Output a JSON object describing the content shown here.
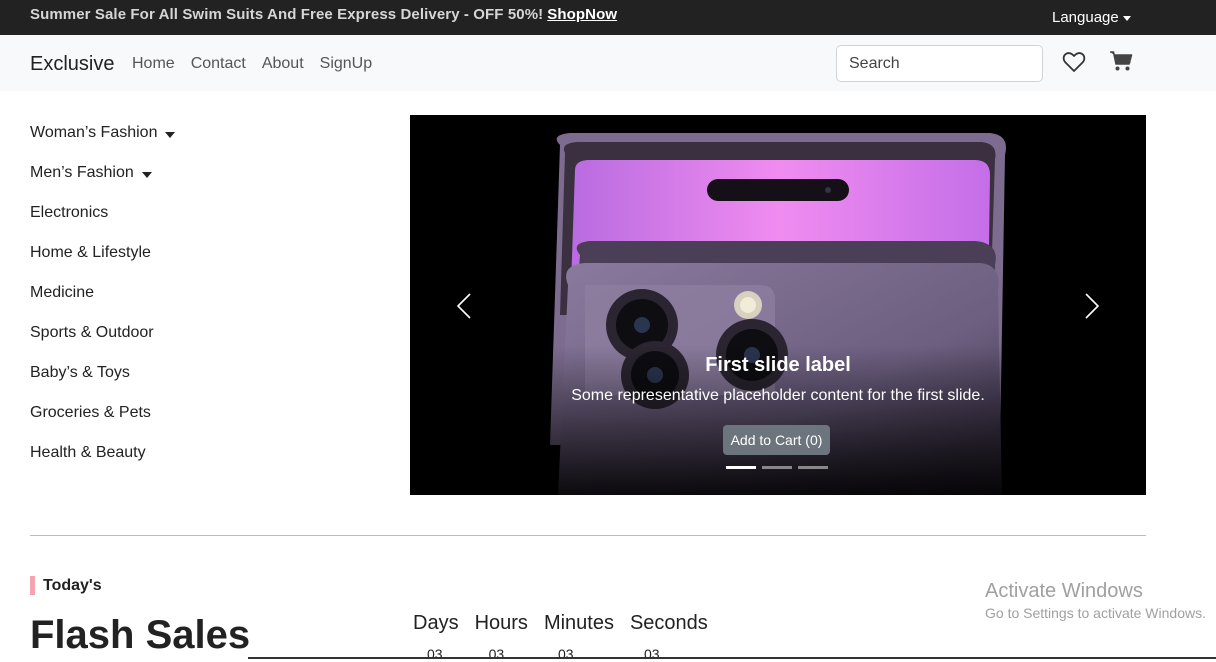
{
  "topbar": {
    "promo_text": "Summer Sale For All Swim Suits And Free Express Delivery - OFF 50%!",
    "promo_link": "ShopNow",
    "language_label": "Language"
  },
  "navbar": {
    "brand": "Exclusive",
    "links": [
      "Home",
      "Contact",
      "About",
      "SignUp"
    ],
    "search_placeholder": "Search",
    "icons": [
      "heart-icon",
      "cart-icon"
    ]
  },
  "sidebar": {
    "items": [
      {
        "label": "Woman’s Fashion",
        "has_dropdown": true
      },
      {
        "label": "Men’s Fashion",
        "has_dropdown": true
      },
      {
        "label": "Electronics",
        "has_dropdown": false
      },
      {
        "label": "Home & Lifestyle",
        "has_dropdown": false
      },
      {
        "label": "Medicine",
        "has_dropdown": false
      },
      {
        "label": "Sports & Outdoor",
        "has_dropdown": false
      },
      {
        "label": "Baby’s & Toys",
        "has_dropdown": false
      },
      {
        "label": "Groceries & Pets",
        "has_dropdown": false
      },
      {
        "label": "Health & Beauty",
        "has_dropdown": false
      }
    ]
  },
  "carousel": {
    "caption_title": "First slide label",
    "caption_text": "Some representative placeholder content for the first slide.",
    "button_label": "Add to Cart (0)",
    "slide_count": 3,
    "active_slide": 1
  },
  "flash": {
    "section_label": "Today's",
    "title": "Flash Sales",
    "timer_labels": [
      "Days",
      "Hours",
      "Minutes",
      "Seconds"
    ],
    "timer_values": [
      "03",
      "03",
      "03",
      "03"
    ]
  },
  "watermark": {
    "title": "Activate Windows",
    "subtitle": "Go to Settings to activate Windows."
  },
  "colors": {
    "topbar_bg": "#222222",
    "navbar_bg": "#f8f9fa",
    "accent": "#f4a3b0",
    "button_bg": "#6c757d"
  }
}
